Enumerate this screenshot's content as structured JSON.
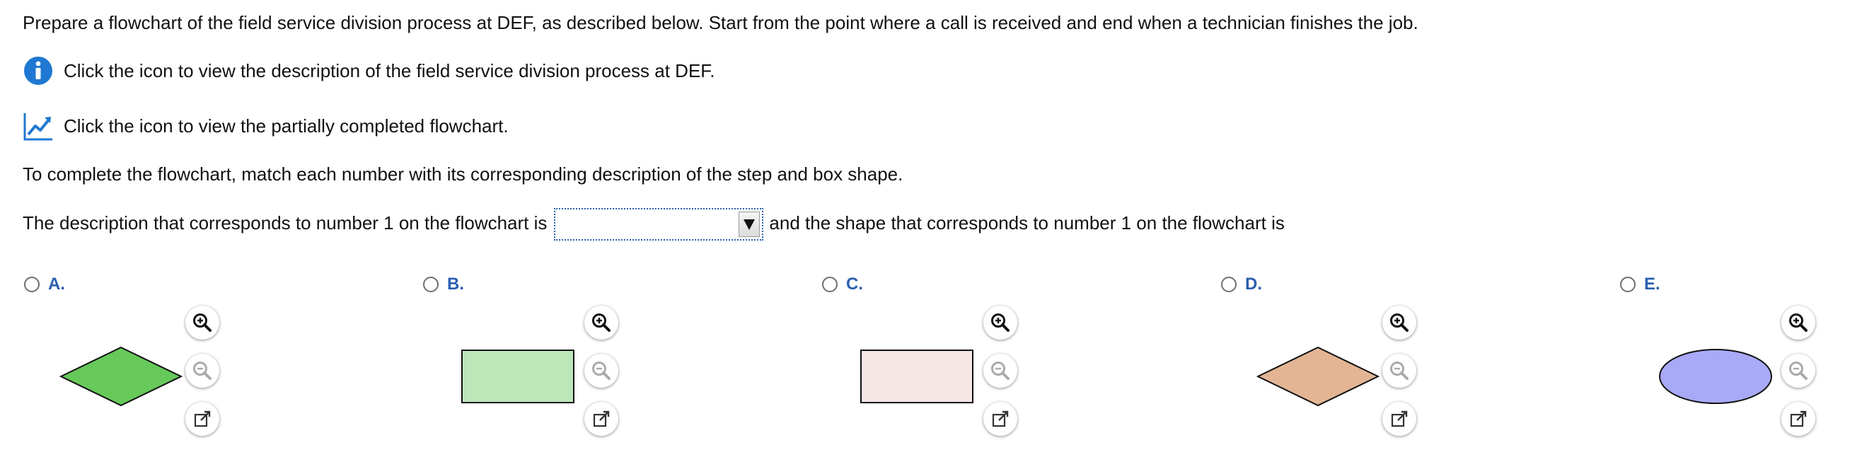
{
  "instructions": {
    "line1": "Prepare a flowchart of the field service division process at DEF, as described below. Start from the point where a call is received and end when a technician finishes the job.",
    "info_text": "Click the icon to view the description of the field service division process at DEF.",
    "chart_text": "Click the icon to view the partially completed flowchart.",
    "line4": "To complete the flowchart, match each number with its corresponding description of the step and box shape."
  },
  "question": {
    "before_dropdown": "The description that corresponds to number 1 on the flowchart is",
    "dropdown_value": "",
    "after_dropdown": "and the shape that corresponds to number 1 on the flowchart is"
  },
  "options": [
    {
      "letter": "A.",
      "shape": "diamond",
      "fill": "#66c95a"
    },
    {
      "letter": "B.",
      "shape": "rectangle",
      "fill": "#bde6b9"
    },
    {
      "letter": "C.",
      "shape": "rectangle",
      "fill": "#f5e5e5"
    },
    {
      "letter": "D.",
      "shape": "diamond",
      "fill": "#e3b594"
    },
    {
      "letter": "E.",
      "shape": "ellipse",
      "fill": "#a8aaf8"
    }
  ],
  "icons": {
    "info": "info-icon",
    "chart": "chart-icon",
    "zoom_in": "zoom-in-icon",
    "zoom_out": "zoom-out-icon",
    "popout": "popout-icon"
  },
  "colors": {
    "accent_blue": "#2a5fb0",
    "info_blue": "#1f78d1"
  }
}
